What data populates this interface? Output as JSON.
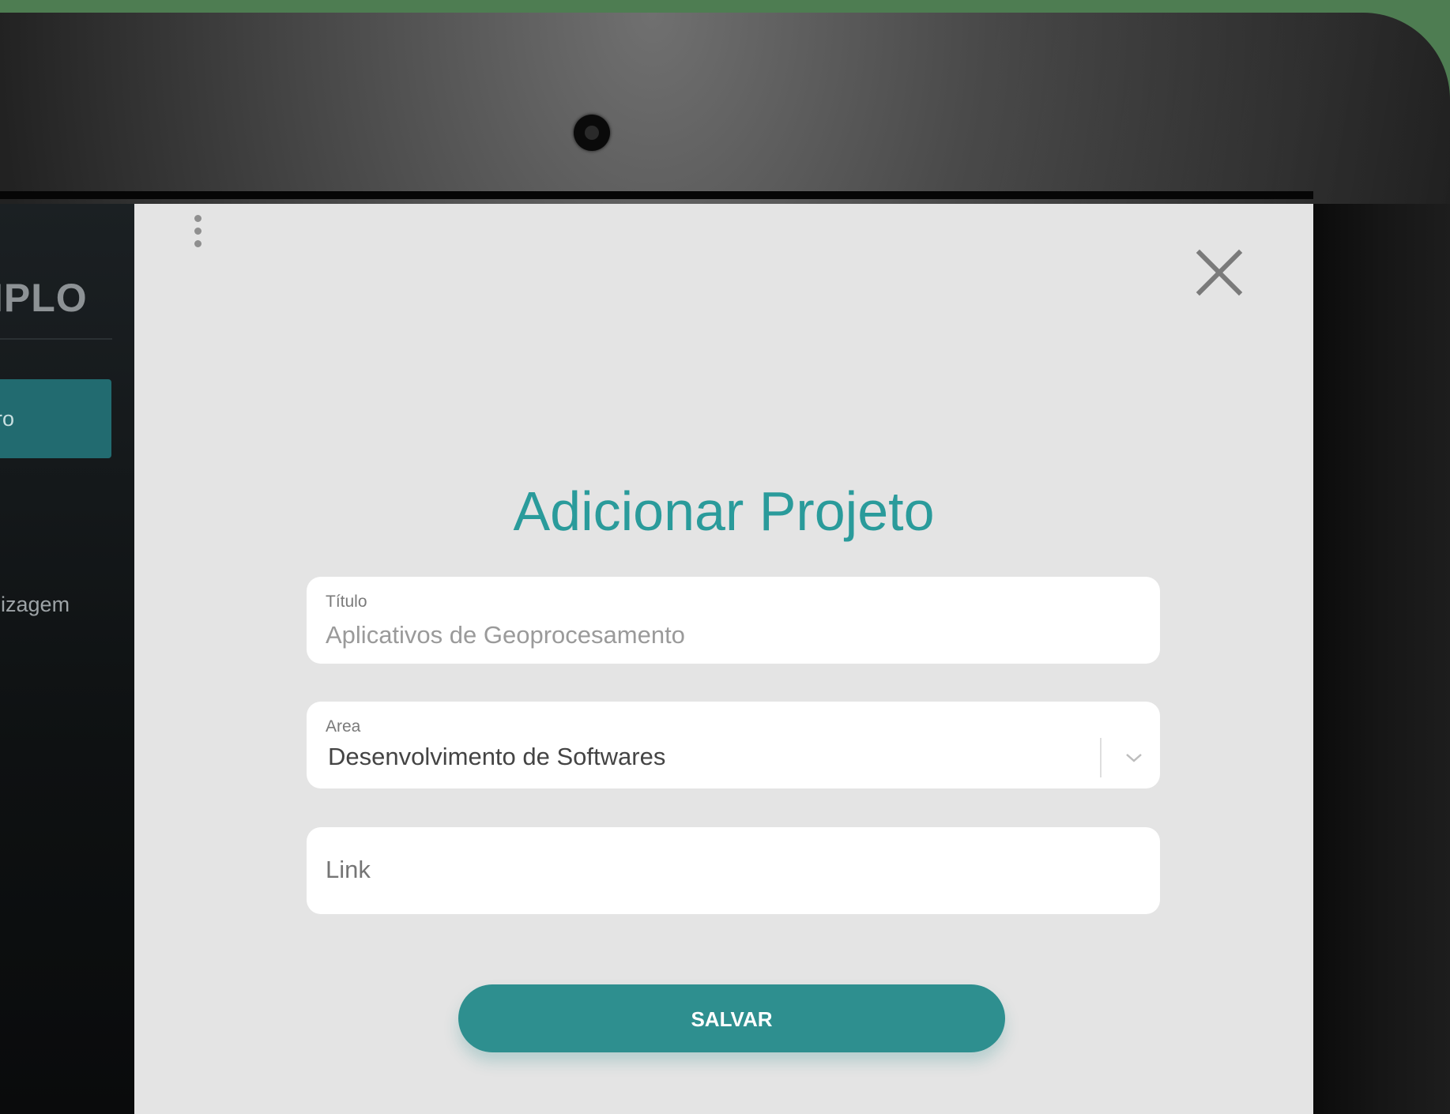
{
  "sidebar": {
    "brand": "IPLO",
    "items": [
      {
        "label": "ro",
        "active": true
      },
      {
        "label": "dizagem",
        "active": false
      }
    ]
  },
  "modal": {
    "title": "Adicionar Projeto",
    "fields": {
      "titulo": {
        "label": "Título",
        "value": "Aplicativos de Geoprocesamento"
      },
      "area": {
        "label": "Area",
        "value": "Desenvolvimento de Softwares"
      },
      "link": {
        "placeholder": "Link"
      }
    },
    "save_label": "SALVAR"
  },
  "icons": {
    "menu": "kebab-icon",
    "close": "close-icon",
    "dropdown": "chevron-down-icon",
    "camera": "camera-icon"
  },
  "colors": {
    "accent": "#2a9b9b",
    "button": "#2e8f8f",
    "sidebar_active": "#226b70",
    "modal_bg": "#e4e4e4"
  }
}
